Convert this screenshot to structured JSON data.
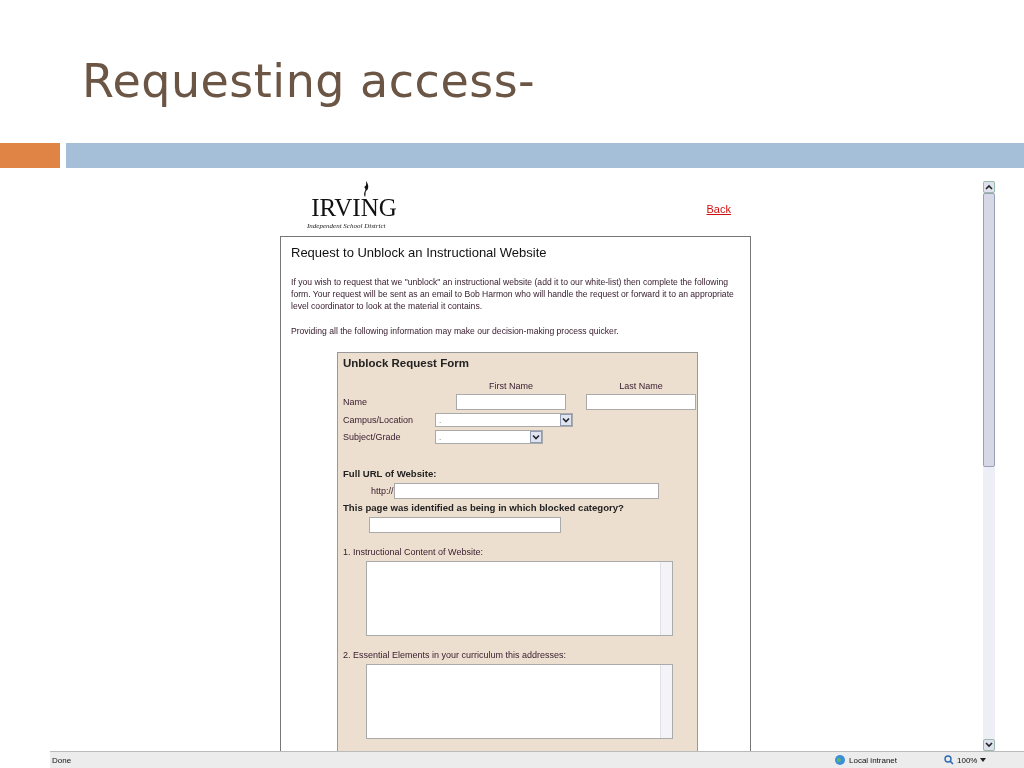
{
  "slide": {
    "title": "Requesting access-"
  },
  "logo": {
    "name": "IRVING",
    "subtitle": "Independent School District"
  },
  "back_link": "Back",
  "page": {
    "heading": "Request to Unblock an Instructional Website",
    "paragraphs": [
      "If you wish to request that we \"unblock\" an instructional website (add it to our white-list) then complete the following form.  Your request will be sent as an email to Bob Harmon who will handle the request or forward it to an appropriate level coordinator to look at the material it contains.",
      "Providing all the following information may make our decision-making process quicker."
    ]
  },
  "form": {
    "title": "Unblock Request Form",
    "name_columns": [
      "First Name",
      "Last Name"
    ],
    "name_label": "Name",
    "selects": [
      {
        "label": "Campus/Location",
        "value": "."
      },
      {
        "label": "Subject/Grade",
        "value": "."
      }
    ],
    "url_heading": "Full URL of Website:",
    "url_prefix": "http://",
    "category_question": "This page was identified as being in which blocked category?",
    "questions": [
      "1.  Instructional Content of Website:",
      "2.  Essential Elements in your curriculum this addresses:"
    ]
  },
  "status_bar": {
    "status": "Done",
    "zone": "Local intranet",
    "zoom": "100%"
  }
}
